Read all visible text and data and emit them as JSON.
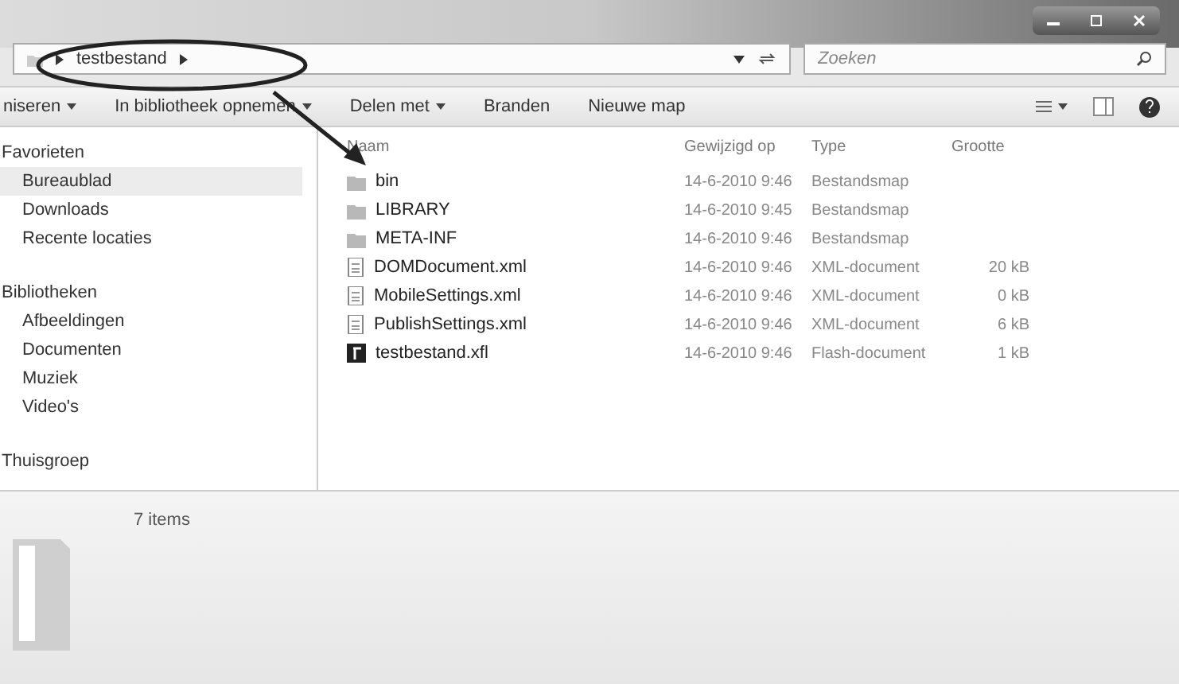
{
  "address_bar": {
    "segments": [
      "testbestand"
    ]
  },
  "search": {
    "placeholder": "Zoeken"
  },
  "toolbar": {
    "items": [
      {
        "label": "niseren",
        "menu": true
      },
      {
        "label": "In bibliotheek opnemen",
        "menu": true
      },
      {
        "label": "Delen met",
        "menu": true
      },
      {
        "label": "Branden",
        "menu": false
      },
      {
        "label": "Nieuwe map",
        "menu": false
      }
    ]
  },
  "sidebar": {
    "groups": [
      {
        "label": "Favorieten",
        "items": [
          {
            "label": "Bureaublad",
            "selected": true
          },
          {
            "label": "Downloads",
            "selected": false
          },
          {
            "label": "Recente locaties",
            "selected": false
          }
        ]
      },
      {
        "label": "Bibliotheken",
        "items": [
          {
            "label": "Afbeeldingen",
            "selected": false
          },
          {
            "label": "Documenten",
            "selected": false
          },
          {
            "label": "Muziek",
            "selected": false
          },
          {
            "label": "Video's",
            "selected": false
          }
        ]
      },
      {
        "label": "Thuisgroep"
      }
    ]
  },
  "table": {
    "columns": [
      "Naam",
      "Gewijzigd op",
      "Type",
      "Grootte"
    ],
    "rows": [
      {
        "kind": "folder",
        "name": "bin",
        "modified": "14-6-2010 9:46",
        "type": "Bestandsmap",
        "size": ""
      },
      {
        "kind": "folder",
        "name": "LIBRARY",
        "modified": "14-6-2010 9:45",
        "type": "Bestandsmap",
        "size": ""
      },
      {
        "kind": "folder",
        "name": "META-INF",
        "modified": "14-6-2010 9:46",
        "type": "Bestandsmap",
        "size": ""
      },
      {
        "kind": "xml",
        "name": "DOMDocument.xml",
        "modified": "14-6-2010 9:46",
        "type": "XML-document",
        "size": "20 kB"
      },
      {
        "kind": "xml",
        "name": "MobileSettings.xml",
        "modified": "14-6-2010 9:46",
        "type": "XML-document",
        "size": "0 kB"
      },
      {
        "kind": "xml",
        "name": "PublishSettings.xml",
        "modified": "14-6-2010 9:46",
        "type": "XML-document",
        "size": "6 kB"
      },
      {
        "kind": "flash",
        "name": "testbestand.xfl",
        "modified": "14-6-2010 9:46",
        "type": "Flash-document",
        "size": "1 kB"
      }
    ]
  },
  "status_bar": {
    "count": "7 items"
  }
}
